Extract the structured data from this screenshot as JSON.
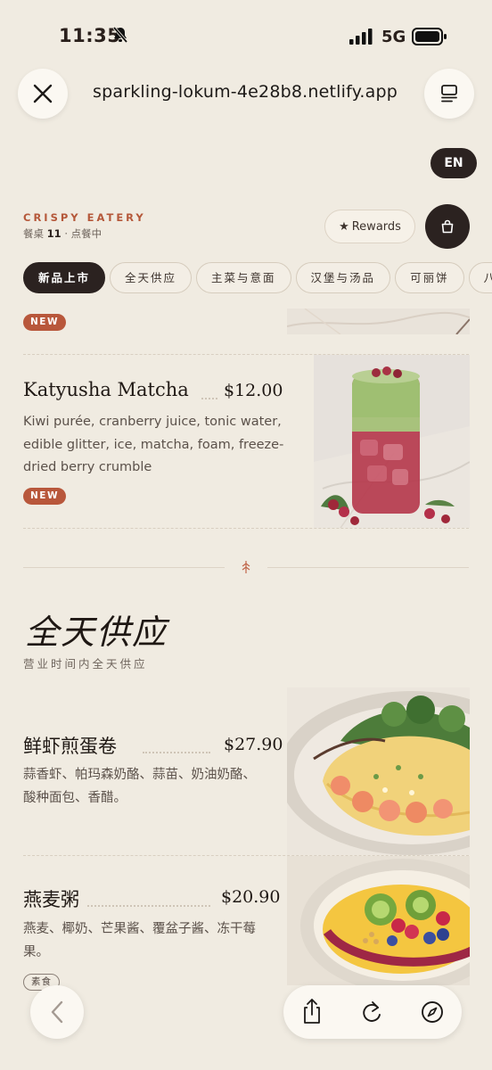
{
  "status_bar": {
    "time": "11:35",
    "network": "5G"
  },
  "browser": {
    "url": "sparkling-lokum-4e28b8.netlify.app"
  },
  "language_toggle": "EN",
  "header": {
    "brand": "CRISPY EATERY",
    "table_prefix": "餐桌",
    "table_number": "11",
    "table_suffix": "· 点餐中",
    "rewards_label": "Rewards"
  },
  "categories": [
    "新品上市",
    "全天供应",
    "主菜与意面",
    "汉堡与汤品",
    "可丽饼",
    "八"
  ],
  "top_item": {
    "badge": "NEW"
  },
  "items": [
    {
      "name": "Katyusha Matcha",
      "price": "$12.00",
      "desc_lines": [
        "Kiwi purée, cranberry juice, tonic water,",
        "edible glitter, ice, matcha, foam, freeze-",
        "dried berry crumble"
      ],
      "badge": "NEW"
    }
  ],
  "section": {
    "title": "全天供应",
    "subtitle": "营业时间内全天供应"
  },
  "all_day_items": [
    {
      "name": "鲜虾煎蛋卷",
      "price": "$27.90",
      "desc_lines": [
        "蒜香虾、帕玛森奶酪、蒜苗、奶油奶酪、",
        "酸种面包、香醋。"
      ]
    },
    {
      "name": "燕麦粥",
      "price": "$20.90",
      "desc_lines": [
        "燕麦、椰奶、芒果酱、覆盆子酱、冻干莓",
        "果。"
      ],
      "badge": "素食"
    }
  ],
  "icons": [
    "close-icon",
    "tabs-icon",
    "star-icon",
    "bag-icon",
    "back-icon",
    "share-icon",
    "reload-icon",
    "compass-icon"
  ],
  "colors": {
    "accent": "#b8573b",
    "dark": "#2b2220",
    "background": "#f0ebe1"
  }
}
